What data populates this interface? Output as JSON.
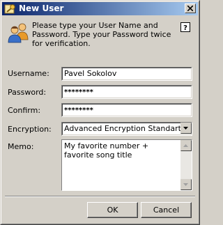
{
  "window": {
    "title": "New User"
  },
  "header": {
    "instructions": "Please type your User Name and Password. Type your Password twice for verification."
  },
  "form": {
    "username": {
      "label": "Username:",
      "value": "Pavel Sokolov"
    },
    "password": {
      "label": "Password:",
      "value": "********"
    },
    "confirm": {
      "label": "Confirm:",
      "value": "********"
    },
    "encryption": {
      "label": "Encryption:",
      "value": "Advanced Encryption Standart"
    },
    "memo": {
      "label": "Memo:",
      "value": "My favorite number + favorite song title"
    }
  },
  "buttons": {
    "ok": "OK",
    "cancel": "Cancel"
  },
  "icons": {
    "title": "key-icon",
    "header": "users-icon",
    "help": "help-icon",
    "close": "close-icon"
  },
  "colors": {
    "titlebar_start": "#0a246a",
    "titlebar_end": "#a6caf0",
    "face": "#d4d0c8"
  }
}
